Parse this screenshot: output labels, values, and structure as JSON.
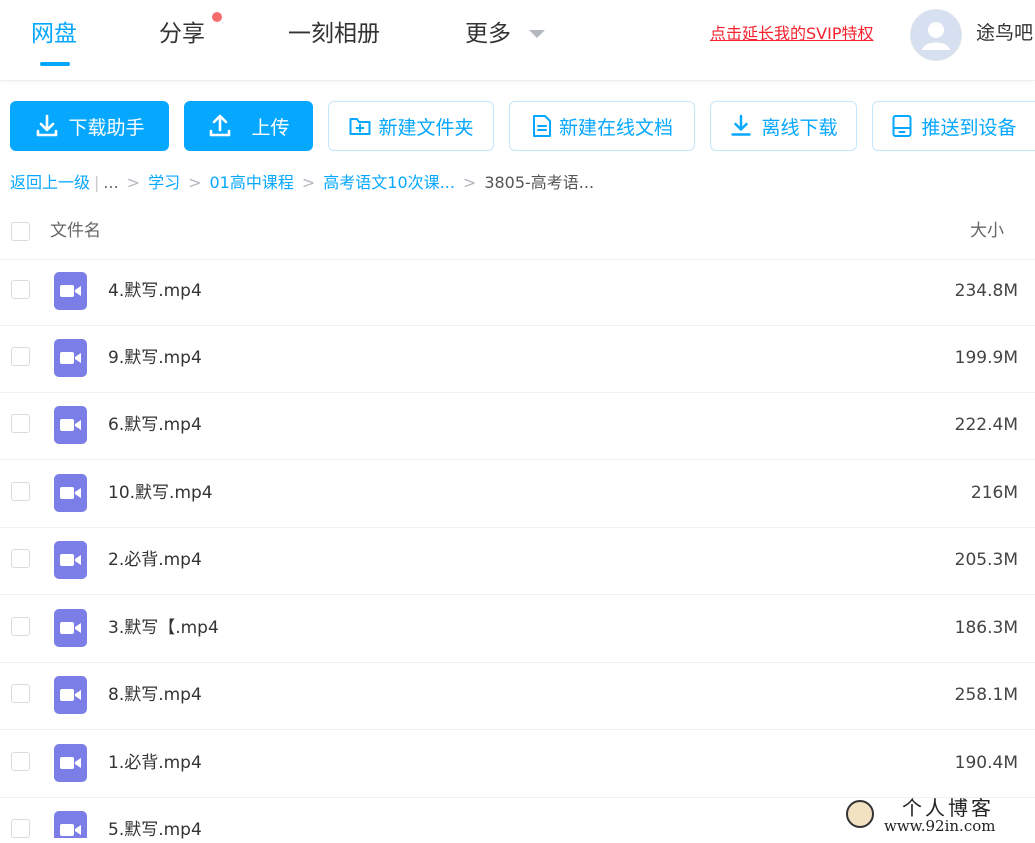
{
  "nav": {
    "tabs": [
      {
        "label": "网盘",
        "active": true
      },
      {
        "label": "分享",
        "has_dot": true
      },
      {
        "label": "一刻相册"
      },
      {
        "label": "更多",
        "has_dropdown": true
      }
    ],
    "svip_link": "点击延长我的SVIP特权",
    "username": "途鸟吧"
  },
  "toolbar": {
    "download_helper": "下载助手",
    "upload": "上传",
    "new_folder": "新建文件夹",
    "new_online_doc": "新建在线文档",
    "offline_download": "离线下载",
    "push_to_device": "推送到设备"
  },
  "breadcrumb": {
    "back": "返回上一级",
    "ellipsis": "...",
    "items": [
      "学习",
      "01高中课程",
      "高考语文10次课..."
    ],
    "current": "3805-高考语..."
  },
  "list": {
    "header_name": "文件名",
    "header_size": "大小",
    "files": [
      {
        "name": "4.默写.mp4",
        "size": "234.8M"
      },
      {
        "name": "9.默写.mp4",
        "size": "199.9M"
      },
      {
        "name": "6.默写.mp4",
        "size": "222.4M"
      },
      {
        "name": "10.默写.mp4",
        "size": "216M"
      },
      {
        "name": "2.必背.mp4",
        "size": "205.3M"
      },
      {
        "name": "3.默写【.mp4",
        "size": "186.3M"
      },
      {
        "name": "8.默写.mp4",
        "size": "258.1M"
      },
      {
        "name": "1.必背.mp4",
        "size": "190.4M"
      },
      {
        "name": "5.默写.mp4",
        "size": ""
      }
    ]
  },
  "watermark": {
    "title": "个人博客",
    "url": "www.92in.com"
  },
  "colors": {
    "accent": "#06a7ff",
    "svip_red": "#f5222d",
    "video_icon": "#7c7ee8"
  }
}
